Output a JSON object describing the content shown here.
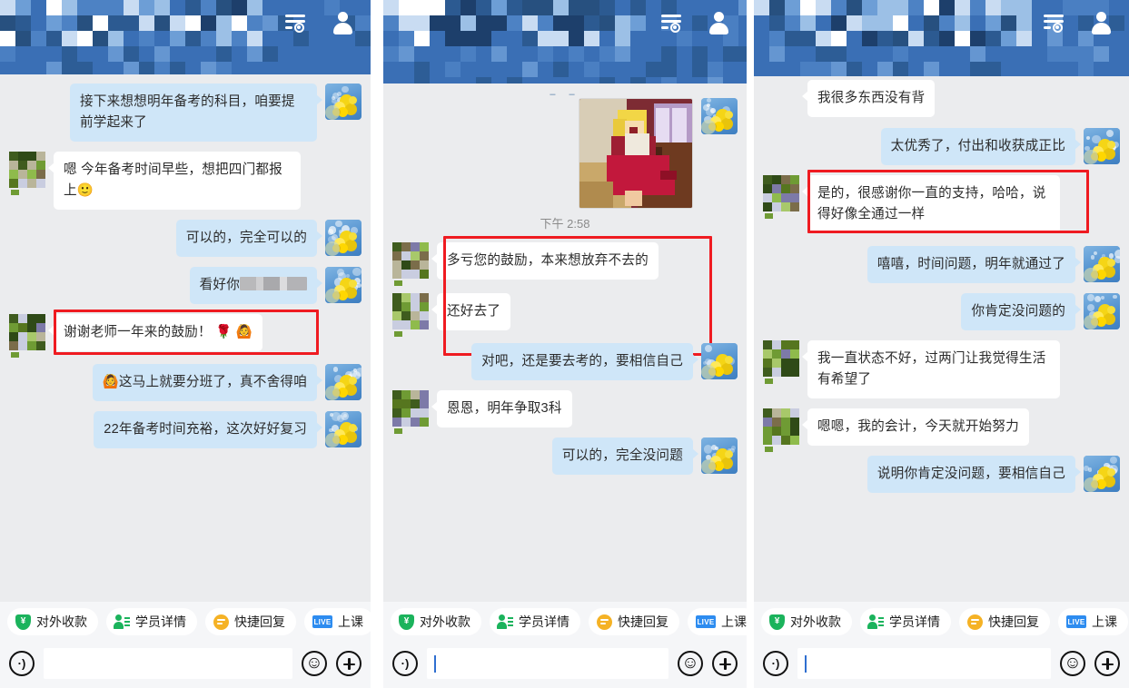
{
  "app": {
    "header_icons": {
      "filter": "filter-sliders-icon",
      "profile": "person-icon"
    },
    "colors": {
      "header_blue": "#3a6fb5",
      "bubble_out": "#cfe6f8",
      "bubble_in": "#ffffff",
      "highlight_red": "#ef1b21",
      "chat_bg": "#ebecee"
    }
  },
  "quickbar": {
    "items": [
      {
        "label": "对外收款",
        "icon": "shield-yuan-icon",
        "symbol": "¥"
      },
      {
        "label": "学员详情",
        "icon": "student-profile-icon"
      },
      {
        "label": "快捷回复",
        "icon": "quick-reply-icon"
      },
      {
        "label": "上课",
        "icon": "live-class-icon",
        "badge": "LIVE"
      }
    ]
  },
  "input": {
    "placeholder": "",
    "value": ""
  },
  "panels": [
    {
      "id": "panel-1",
      "messages": [
        {
          "side": "out",
          "text": "接下来想想明年备考的科目，咱要提前学起来了",
          "avatar": "flower-avatar"
        },
        {
          "side": "in",
          "text": "嗯 今年备考时间早些，想把四门都报上🙂",
          "avatar": "mosaic-avatar"
        },
        {
          "side": "out",
          "text": "可以的，完全可以的",
          "avatar": "flower-avatar"
        },
        {
          "side": "out",
          "text": "看好你",
          "redacted": true,
          "avatar": "flower-avatar"
        },
        {
          "side": "in",
          "text": "谢谢老师一年来的鼓励！ 🌹 🙆",
          "avatar": "mosaic-avatar",
          "highlighted": true
        },
        {
          "side": "out",
          "text": "🙆这马上就要分班了，真不舍得咱",
          "avatar": "flower-avatar"
        },
        {
          "side": "out",
          "text": "22年备考时间充裕，这次好好复习",
          "avatar": "flower-avatar"
        }
      ]
    },
    {
      "id": "panel-2",
      "timestamp": "下午 2:58",
      "photo": {
        "alt": "cartoon-woman-reading-letter",
        "name": "chat-photo"
      },
      "messages": [
        {
          "side": "in",
          "text": "多亏您的鼓励，本来想放弃不去的",
          "avatar": "mosaic-avatar",
          "highlighted": true
        },
        {
          "side": "in",
          "text": "还好去了",
          "avatar": "mosaic-avatar",
          "highlighted": true
        },
        {
          "side": "out",
          "text": "对吧，还是要去考的，要相信自己",
          "avatar": "flower-avatar"
        },
        {
          "side": "in",
          "text": "恩恩，明年争取3科",
          "avatar": "mosaic-avatar"
        },
        {
          "side": "out",
          "text": "可以的，完全没问题",
          "avatar": "flower-avatar"
        }
      ]
    },
    {
      "id": "panel-3",
      "messages": [
        {
          "side": "in",
          "text": "我很多东西没有背",
          "avatar": "none"
        },
        {
          "side": "out",
          "text": "太优秀了，付出和收获成正比",
          "avatar": "flower-avatar"
        },
        {
          "side": "in",
          "text": "是的，很感谢你一直的支持，哈哈，说得好像全通过一样",
          "avatar": "mosaic-avatar",
          "highlighted": true
        },
        {
          "side": "out",
          "text": "嘻嘻，时间问题，明年就通过了",
          "avatar": "flower-avatar"
        },
        {
          "side": "out",
          "text": "你肯定没问题的",
          "avatar": "flower-avatar"
        },
        {
          "side": "in",
          "text": "我一直状态不好，过两门让我觉得生活有希望了",
          "avatar": "mosaic-avatar"
        },
        {
          "side": "in",
          "text": "嗯嗯，我的会计，今天就开始努力",
          "avatar": "mosaic-avatar"
        },
        {
          "side": "out",
          "text": "说明你肯定没问题，要相信自己",
          "avatar": "flower-avatar"
        }
      ]
    }
  ]
}
